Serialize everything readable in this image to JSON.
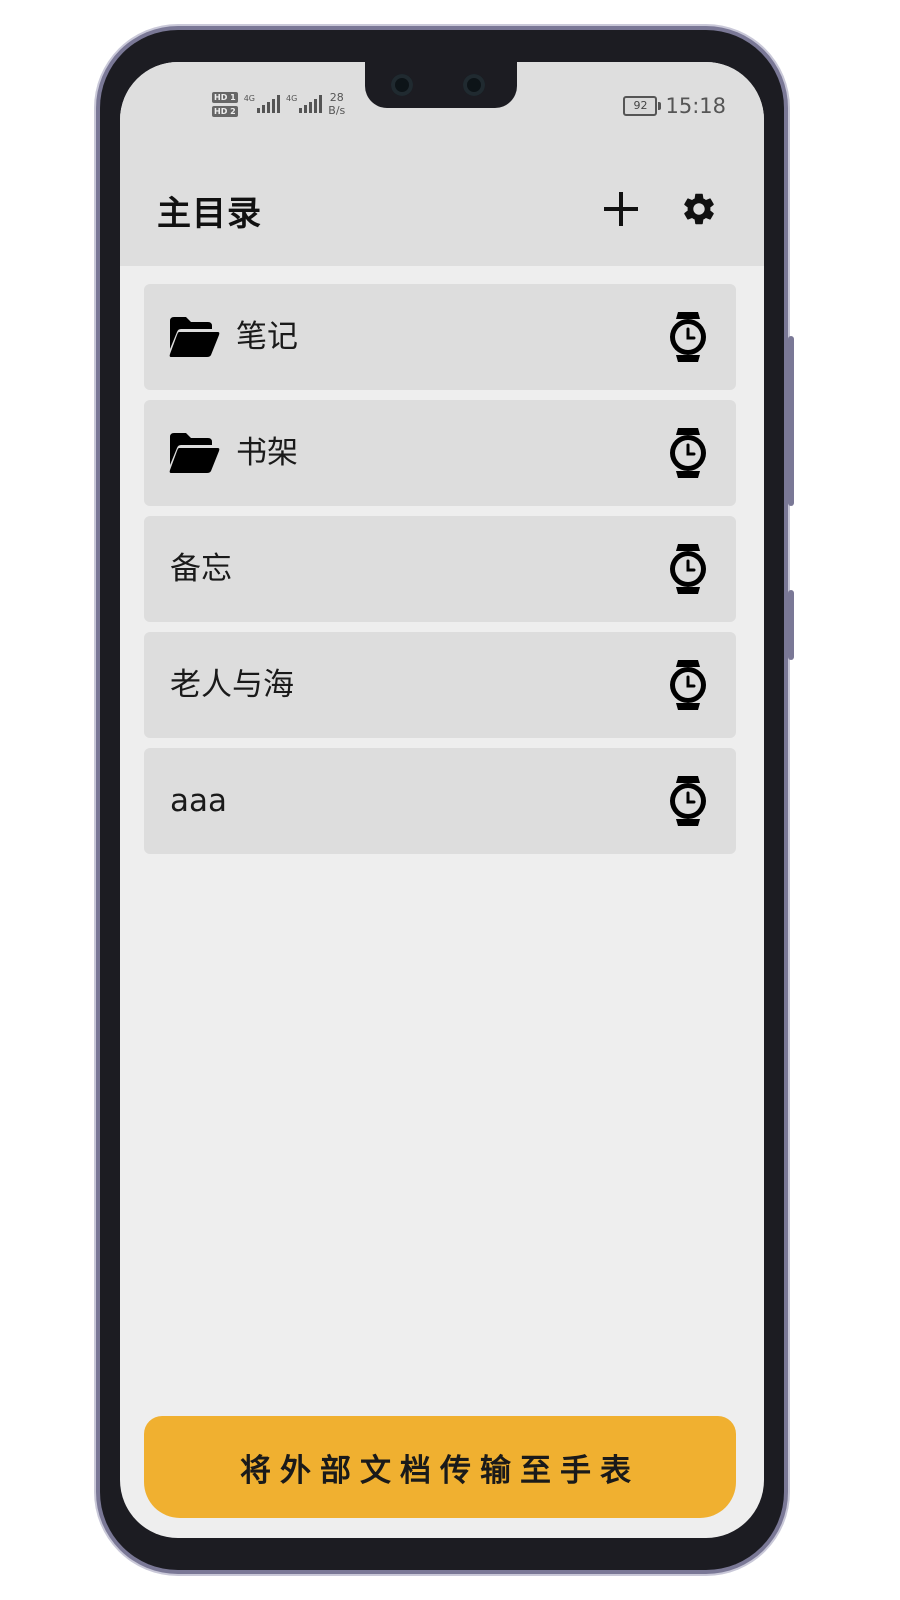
{
  "status_bar": {
    "hd1": "HD 1",
    "hd2": "HD 2",
    "net1": "4G",
    "net2": "4G",
    "speed_value": "28",
    "speed_unit": "B/s",
    "battery": "92",
    "time": "15:18"
  },
  "header": {
    "title": "主目录",
    "add_icon": "plus-icon",
    "settings_icon": "gear-icon"
  },
  "items": [
    {
      "label": "笔记",
      "type": "folder",
      "action_icon": "watch-icon"
    },
    {
      "label": "书架",
      "type": "folder",
      "action_icon": "watch-icon"
    },
    {
      "label": "备忘",
      "type": "file",
      "action_icon": "watch-icon"
    },
    {
      "label": "老人与海",
      "type": "file",
      "action_icon": "watch-icon"
    },
    {
      "label": "aaa",
      "type": "file",
      "action_icon": "watch-icon"
    }
  ],
  "footer": {
    "transfer_label": "将外部文档传输至手表"
  },
  "colors": {
    "accent": "#f0b030",
    "header_bg": "#dedede",
    "item_bg": "#dddddd",
    "screen_bg": "#eeeeee"
  }
}
